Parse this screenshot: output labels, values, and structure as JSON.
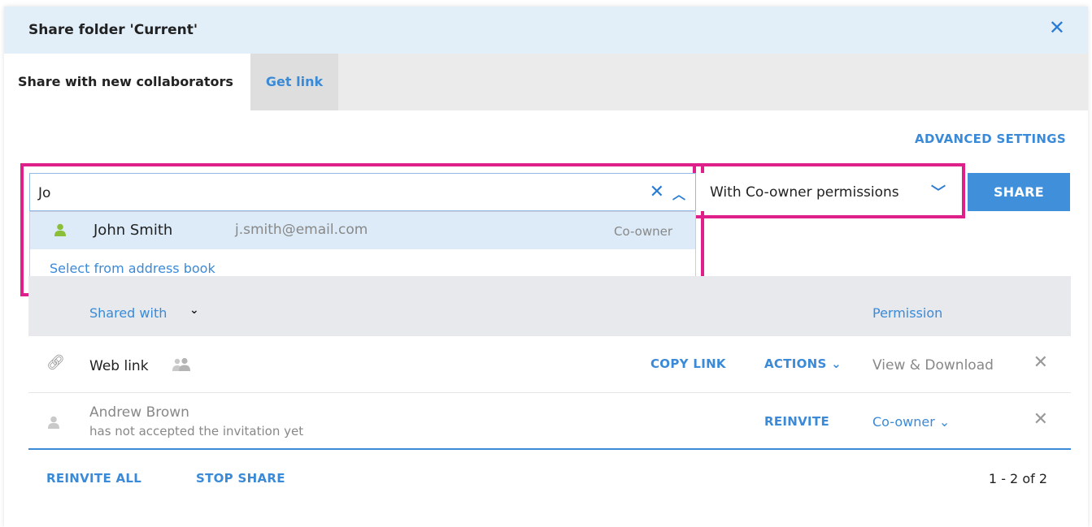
{
  "dialog": {
    "title": "Share folder 'Current'",
    "close_icon": "close-icon"
  },
  "tabs": [
    {
      "label": "Share with new collaborators",
      "active": true
    },
    {
      "label": "Get link",
      "active": false
    }
  ],
  "advanced_settings": "ADVANCED SETTINGS",
  "search": {
    "value": "Jo",
    "clear_icon": "close-icon",
    "collapse_icon": "chevron-up-icon"
  },
  "suggestions": [
    {
      "name": "John Smith",
      "email": "j.smith@email.com",
      "role": "Co-owner",
      "icon": "person-icon"
    }
  ],
  "address_book_link": "Select from address book",
  "permission_select": {
    "value": "With Co-owner permissions",
    "icon": "chevron-down-icon"
  },
  "share_button": "SHARE",
  "table": {
    "columns": {
      "shared_with": "Shared with",
      "permission": "Permission"
    },
    "rows": [
      {
        "type": "link",
        "name": "Web link",
        "copy_label": "COPY LINK",
        "actions_label": "ACTIONS",
        "permission": "View & Download"
      },
      {
        "type": "user",
        "name": "Andrew Brown",
        "status": "has not accepted the invitation yet",
        "reinvite_label": "REINVITE",
        "permission": "Co-owner"
      }
    ]
  },
  "footer": {
    "reinvite_all": "REINVITE ALL",
    "stop_share": "STOP SHARE",
    "pagination": "1 - 2 of 2"
  },
  "colors": {
    "accent": "#3a8ad8",
    "highlight": "#e0208a",
    "header_bg": "#e2eef8",
    "suggestion_user": "#8bbf3a"
  }
}
